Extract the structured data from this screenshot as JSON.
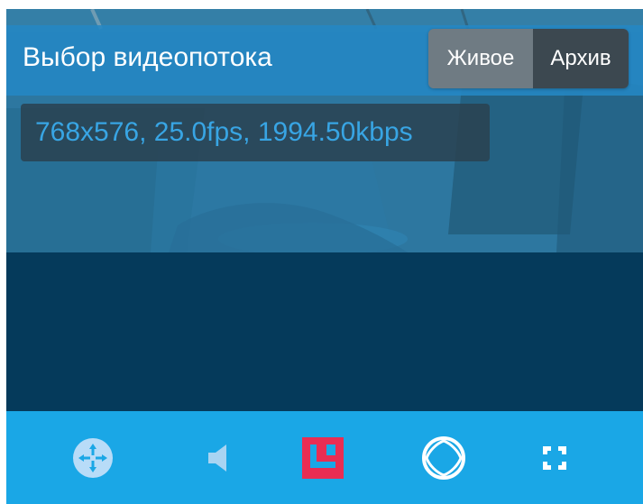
{
  "header": {
    "title": "Выбор видеопотока"
  },
  "stream_mode": {
    "live_label": "Живое",
    "archive_label": "Архив",
    "selected": "Живое"
  },
  "stream_info": {
    "text": "768x576, 25.0fps, 1994.50kbps"
  },
  "toolbar": {
    "items": [
      {
        "icon": "ptz-control-icon"
      },
      {
        "icon": "volume-icon"
      },
      {
        "icon": "layout-icon"
      },
      {
        "icon": "fisheye-icon"
      },
      {
        "icon": "fullscreen-icon"
      }
    ]
  },
  "colors": {
    "title_bar": "#2488c4",
    "toolbar": "#1aa7e6",
    "stream_text": "#38a5e4",
    "active_tool": "#e92d53",
    "dark_panel": "#053a5b"
  }
}
